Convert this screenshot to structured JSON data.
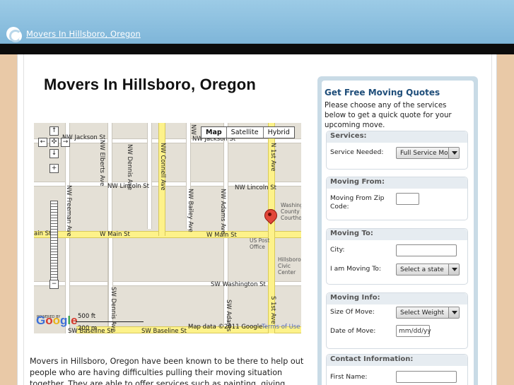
{
  "header": {
    "site_link": "Movers In Hillsboro, Oregon"
  },
  "main": {
    "title": "Movers In Hillsboro, Oregon",
    "body_text": "Movers in Hillsboro, Oregon have been known to be there to help out people who are having difficulties pulling their moving situation together. They are able to offer services such as painting, giving people storage for their extra"
  },
  "map": {
    "types": [
      "Map",
      "Satellite",
      "Hybrid"
    ],
    "streets": {
      "nw_jackson_1": "NW Jackson St",
      "nw_jackson_2": "NW Jackson St",
      "nw_lincoln_1": "NW Lincoln St",
      "nw_lincoln_2": "NW Lincoln St",
      "w_main_1": "W Main St",
      "w_main_2": "W Main St",
      "w_main_3": "ain St",
      "sw_washington": "SW Washington St",
      "sw_baseline_1": "SW Baseline St",
      "sw_baseline_2": "SW Baseline St",
      "nw_elberts": "NW Elberts Ave",
      "nw_dennis": "NW Dennis Ave",
      "nw_connell": "NW Connell Ave",
      "nw_bailey": "NW Bailey Ave",
      "nw_adams": "NW Adams Ave",
      "n_1st": "N 1st Ave",
      "nw_freeman": "NW Freeman Ave",
      "sw_dennis": "SW Dennis Ave",
      "sw_adams": "SW Adams Ave",
      "s_1st": "S 1st Ave",
      "nw_partial": "NW"
    },
    "poi": {
      "post_office": "US Post Office",
      "courthouse": "Washington County Courthouse",
      "civic": "Hillsboro Civic Center"
    },
    "scale_ft": "500 ft",
    "scale_m": "200 m",
    "powered_by": "POWERED BY",
    "logo": "Google",
    "map_data": "Map data ©2011 Google -",
    "terms": "Terms of Use"
  },
  "quote_panel": {
    "title": "Get Free Moving Quotes",
    "description": "Please choose any of the services below to get a quick quote for your upcoming move.",
    "services": {
      "heading": "Services:",
      "service_label": "Service Needed:",
      "service_value": "Full Service Moving"
    },
    "moving_from": {
      "heading": "Moving From:",
      "zip_label": "Moving From Zip Code:",
      "zip_value": ""
    },
    "moving_to": {
      "heading": "Moving To:",
      "city_label": "City:",
      "city_value": "",
      "state_label": "I am Moving To:",
      "state_value": "Select a state"
    },
    "moving_info": {
      "heading": "Moving Info:",
      "size_label": "Size Of Move:",
      "size_value": "Select Weight",
      "date_label": "Date of Move:",
      "date_placeholder": "mm/dd/yy"
    },
    "contact": {
      "heading": "Contact Information:",
      "first_name_label": "First Name:",
      "first_name_value": ""
    }
  },
  "colors": {
    "topbar": "#8fc1e0",
    "background": "#e9c9a7",
    "panel_border": "#c9dbe6",
    "quote_title": "#1f4e7a",
    "road_yellow": "#fdf28a"
  }
}
